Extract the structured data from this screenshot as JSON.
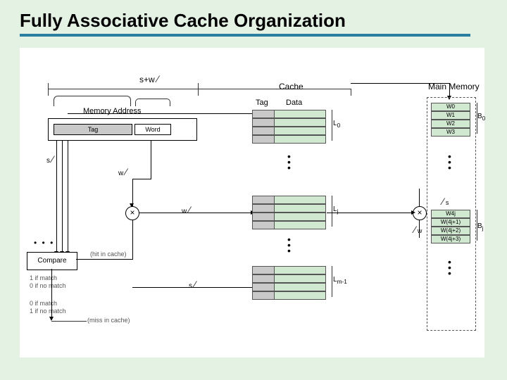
{
  "title": "Fully Associative Cache Organization",
  "labels": {
    "memory_address": "Memory Address",
    "tag": "Tag",
    "word": "Word",
    "sw": "s+w",
    "s": "s",
    "w": "w",
    "cache": "Cache",
    "cache_tag_col": "Tag",
    "cache_data_col": "Data",
    "compare": "Compare",
    "hit": "(hit in cache)",
    "miss": "(miss in cache)",
    "match1": "1 if match",
    "match0": "0 if no match",
    "nomatch0": "0 if match",
    "nomatch1": "1 if no match",
    "L0": "L",
    "L0sub": "0",
    "Lj": "L",
    "Ljsub": "j",
    "Lm": "L",
    "Lmsub": "m-1",
    "main_memory": "Main Memory",
    "B0": "B",
    "B0sub": "0",
    "Bj": "B",
    "Bjsub": "j",
    "W0": "W0",
    "W1": "W1",
    "W2": "W2",
    "W3": "W3",
    "W4j": "W4j",
    "W4j1": "W(4j+1)",
    "W4j2": "W(4j+2)",
    "W4j3": "W(4j+3)",
    "dots": "•\n•\n•",
    "hdots": "• • •"
  }
}
